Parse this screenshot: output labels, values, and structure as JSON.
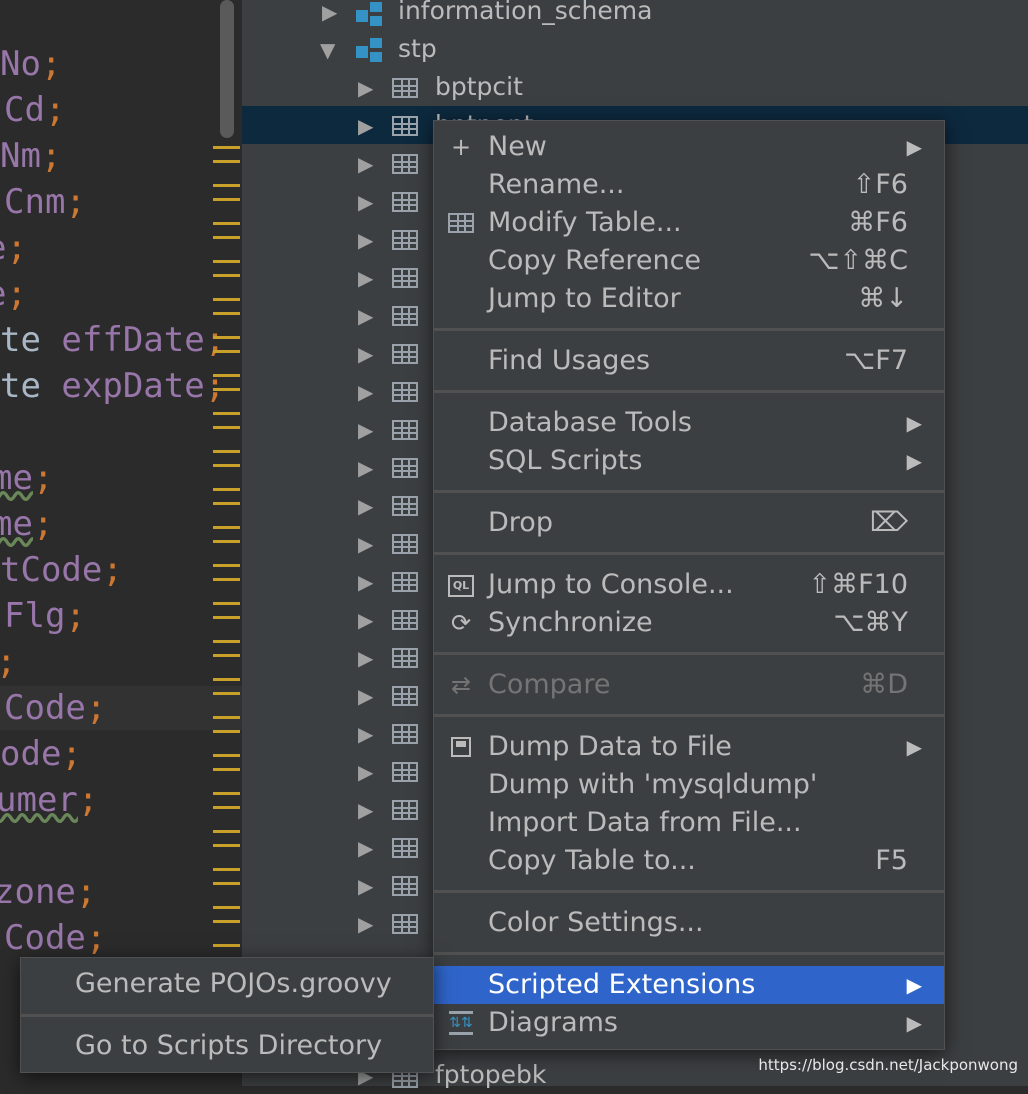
{
  "editor": {
    "lines": [
      {
        "text": "No",
        "semi": ";"
      },
      {
        "text": "Cd",
        "semi": ";"
      },
      {
        "text": "Nm",
        "semi": ";"
      },
      {
        "text": "Cnm",
        "semi": ";"
      },
      {
        "text": "e",
        "semi": ";"
      },
      {
        "text": "e",
        "semi": ";"
      },
      {
        "text_plain": "te ",
        "text": "effDate",
        "semi": ";"
      },
      {
        "text_plain": "te ",
        "text": "expDate",
        "semi": ";"
      },
      {
        "text": "me",
        "semi": ";"
      },
      {
        "text": "me",
        "semi": ";"
      },
      {
        "text": "tCode",
        "semi": ";"
      },
      {
        "text": "Flg",
        "semi": ";"
      },
      {
        "text": "",
        "semi": ";"
      },
      {
        "text": "Code",
        "semi": ";"
      },
      {
        "text": "ode",
        "semi": ";"
      },
      {
        "text": "umer",
        "semi": ";"
      },
      {
        "text": "zone",
        "semi": ";"
      },
      {
        "text": "Code",
        "semi": ";"
      }
    ]
  },
  "tree": {
    "schema_top": "information_schema",
    "schema_stp": "stp",
    "table_first": "bptpcit",
    "table_selected_partial": "bptpent",
    "table_bottom": "fptopebk"
  },
  "menu": {
    "new": {
      "label": "New"
    },
    "rename": {
      "label": "Rename...",
      "shortcut": "⇧F6"
    },
    "modify": {
      "label": "Modify Table...",
      "shortcut": "⌘F6"
    },
    "copy_ref": {
      "label": "Copy Reference",
      "shortcut": "⌥⇧⌘C"
    },
    "jump_editor": {
      "label": "Jump to Editor",
      "shortcut": "⌘↓"
    },
    "find_usages": {
      "label": "Find Usages",
      "shortcut": "⌥F7"
    },
    "db_tools": {
      "label": "Database Tools"
    },
    "sql_scripts": {
      "label": "SQL Scripts"
    },
    "drop": {
      "label": "Drop"
    },
    "jump_console": {
      "label": "Jump to Console...",
      "shortcut": "⇧⌘F10"
    },
    "synchronize": {
      "label": "Synchronize",
      "shortcut": "⌥⌘Y"
    },
    "compare": {
      "label": "Compare",
      "shortcut": "⌘D"
    },
    "dump_file": {
      "label": "Dump Data to File"
    },
    "dump_mysqldump": {
      "label": "Dump with 'mysqldump'"
    },
    "import_data": {
      "label": "Import Data from File..."
    },
    "copy_table": {
      "label": "Copy Table to...",
      "shortcut": "F5"
    },
    "color_settings": {
      "label": "Color Settings..."
    },
    "scripted_ext": {
      "label": "Scripted Extensions"
    },
    "diagrams": {
      "label": "Diagrams"
    },
    "icons": {
      "submenu_arrow": "▶",
      "plus": "+",
      "drop_icon": "⌦"
    }
  },
  "submenu": {
    "generate": "Generate POJOs.groovy",
    "go_scripts": "Go to Scripts Directory"
  },
  "watermark": "https://blog.csdn.net/Jackponwong",
  "colors": {
    "selection": "#2f65ca",
    "menu_bg": "#3c3f41",
    "tree_selected": "#0d293e"
  }
}
